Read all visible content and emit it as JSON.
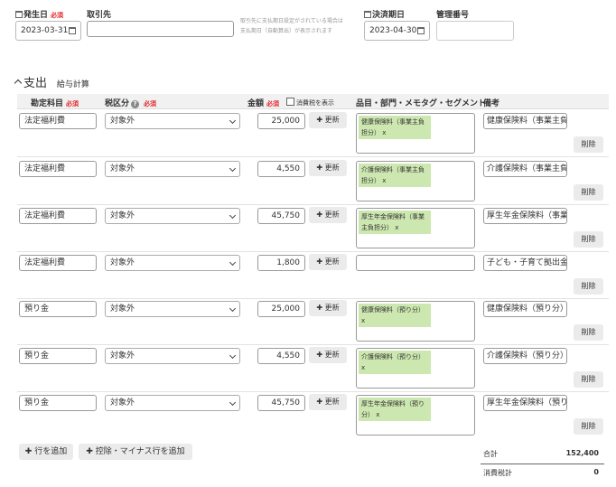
{
  "header": {
    "issue_date_label": "発生日",
    "issue_date_required": "必須",
    "issue_date_value": "2023-03-31",
    "partner_label": "取引先",
    "partner_value": "",
    "partner_hint_1": "取引先に支払期日設定がされている場合は",
    "partner_hint_2": "支払期日（自動算出）が表示されます",
    "due_date_label": "決済期日",
    "due_date_value": "2023-04-30",
    "mgmt_number_label": "管理番号",
    "mgmt_number_value": ""
  },
  "section": {
    "title": "支出",
    "subtitle": "給与計算"
  },
  "table": {
    "col_account": "勘定科目",
    "col_account_required": "必須",
    "col_tax": "税区分",
    "col_tax_help": "?",
    "col_tax_required": "必須",
    "col_amount": "金額",
    "col_amount_required": "必須",
    "col_show_tax": "消費税を表示",
    "col_tags": "品目・部門・メモタグ・セグメント",
    "col_note": "備考",
    "update_label": "✚ 更新",
    "delete_label": "削除",
    "rows": [
      {
        "account": "法定福利費",
        "tax": "対象外",
        "amount": "25,000",
        "tag": "健康保険料（事業主負担分） x",
        "note": "健康保険料（事業主負担"
      },
      {
        "account": "法定福利費",
        "tax": "対象外",
        "amount": "4,550",
        "tag": "介護保険料（事業主負担分） x",
        "note": "介護保険料（事業主負担"
      },
      {
        "account": "法定福利費",
        "tax": "対象外",
        "amount": "45,750",
        "tag": "厚生年金保険料（事業主負担分） x",
        "note": "厚生年金保険料（事業主"
      },
      {
        "account": "法定福利費",
        "tax": "対象外",
        "amount": "1,800",
        "tag": "",
        "note": "子ども・子育て拠出金"
      },
      {
        "account": "預り金",
        "tax": "対象外",
        "amount": "25,000",
        "tag": "健康保険料（預り分） x",
        "note": "健康保険料（預り分）"
      },
      {
        "account": "預り金",
        "tax": "対象外",
        "amount": "4,550",
        "tag": "介護保険料（預り分） x",
        "note": "介護保険料（預り分）"
      },
      {
        "account": "預り金",
        "tax": "対象外",
        "amount": "45,750",
        "tag": "厚生年金保険料（預り分） x",
        "note": "厚生年金保険料（預り分"
      }
    ]
  },
  "footer": {
    "add_row_label": "✚ 行を追加",
    "add_minus_row_label": "✚ 控除・マイナス行を追加",
    "total_label": "合計",
    "total_value": "152,400",
    "tax_total_label": "消費税計",
    "tax_total_value": "0"
  }
}
